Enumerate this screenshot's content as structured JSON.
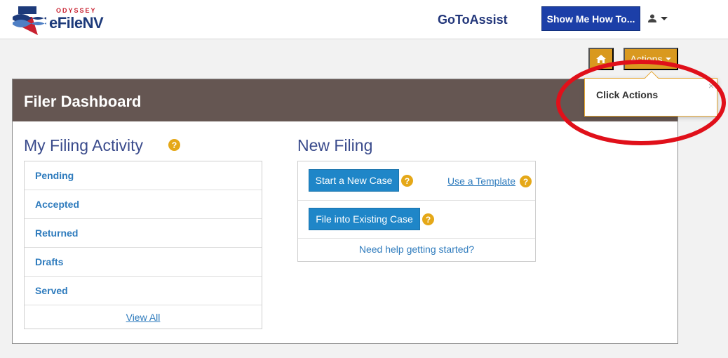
{
  "header": {
    "logo_small": "ODYSSEY",
    "logo_main": "eFileNV",
    "goto_assist": "GoToAssist",
    "show_me_button": "Show Me How To..."
  },
  "actions": {
    "actions_label": "Actions"
  },
  "dashboard": {
    "title": "Filer Dashboard"
  },
  "filing_activity": {
    "title": "My Filing Activity",
    "items": [
      "Pending",
      "Accepted",
      "Returned",
      "Drafts",
      "Served"
    ],
    "view_all": "View All"
  },
  "new_filing": {
    "title": "New Filing",
    "start_new_case": "Start a New Case",
    "use_template": "Use a Template",
    "file_existing": "File into Existing Case",
    "need_help": "Need help getting started?"
  },
  "callout": {
    "text": "Click Actions",
    "close": "×"
  },
  "colors": {
    "brand_blue": "#1c3fa8",
    "action_orange": "#d9991f",
    "panel_header": "#655652",
    "link_blue": "#2e7bbd",
    "annotation_red": "#e0101a"
  }
}
